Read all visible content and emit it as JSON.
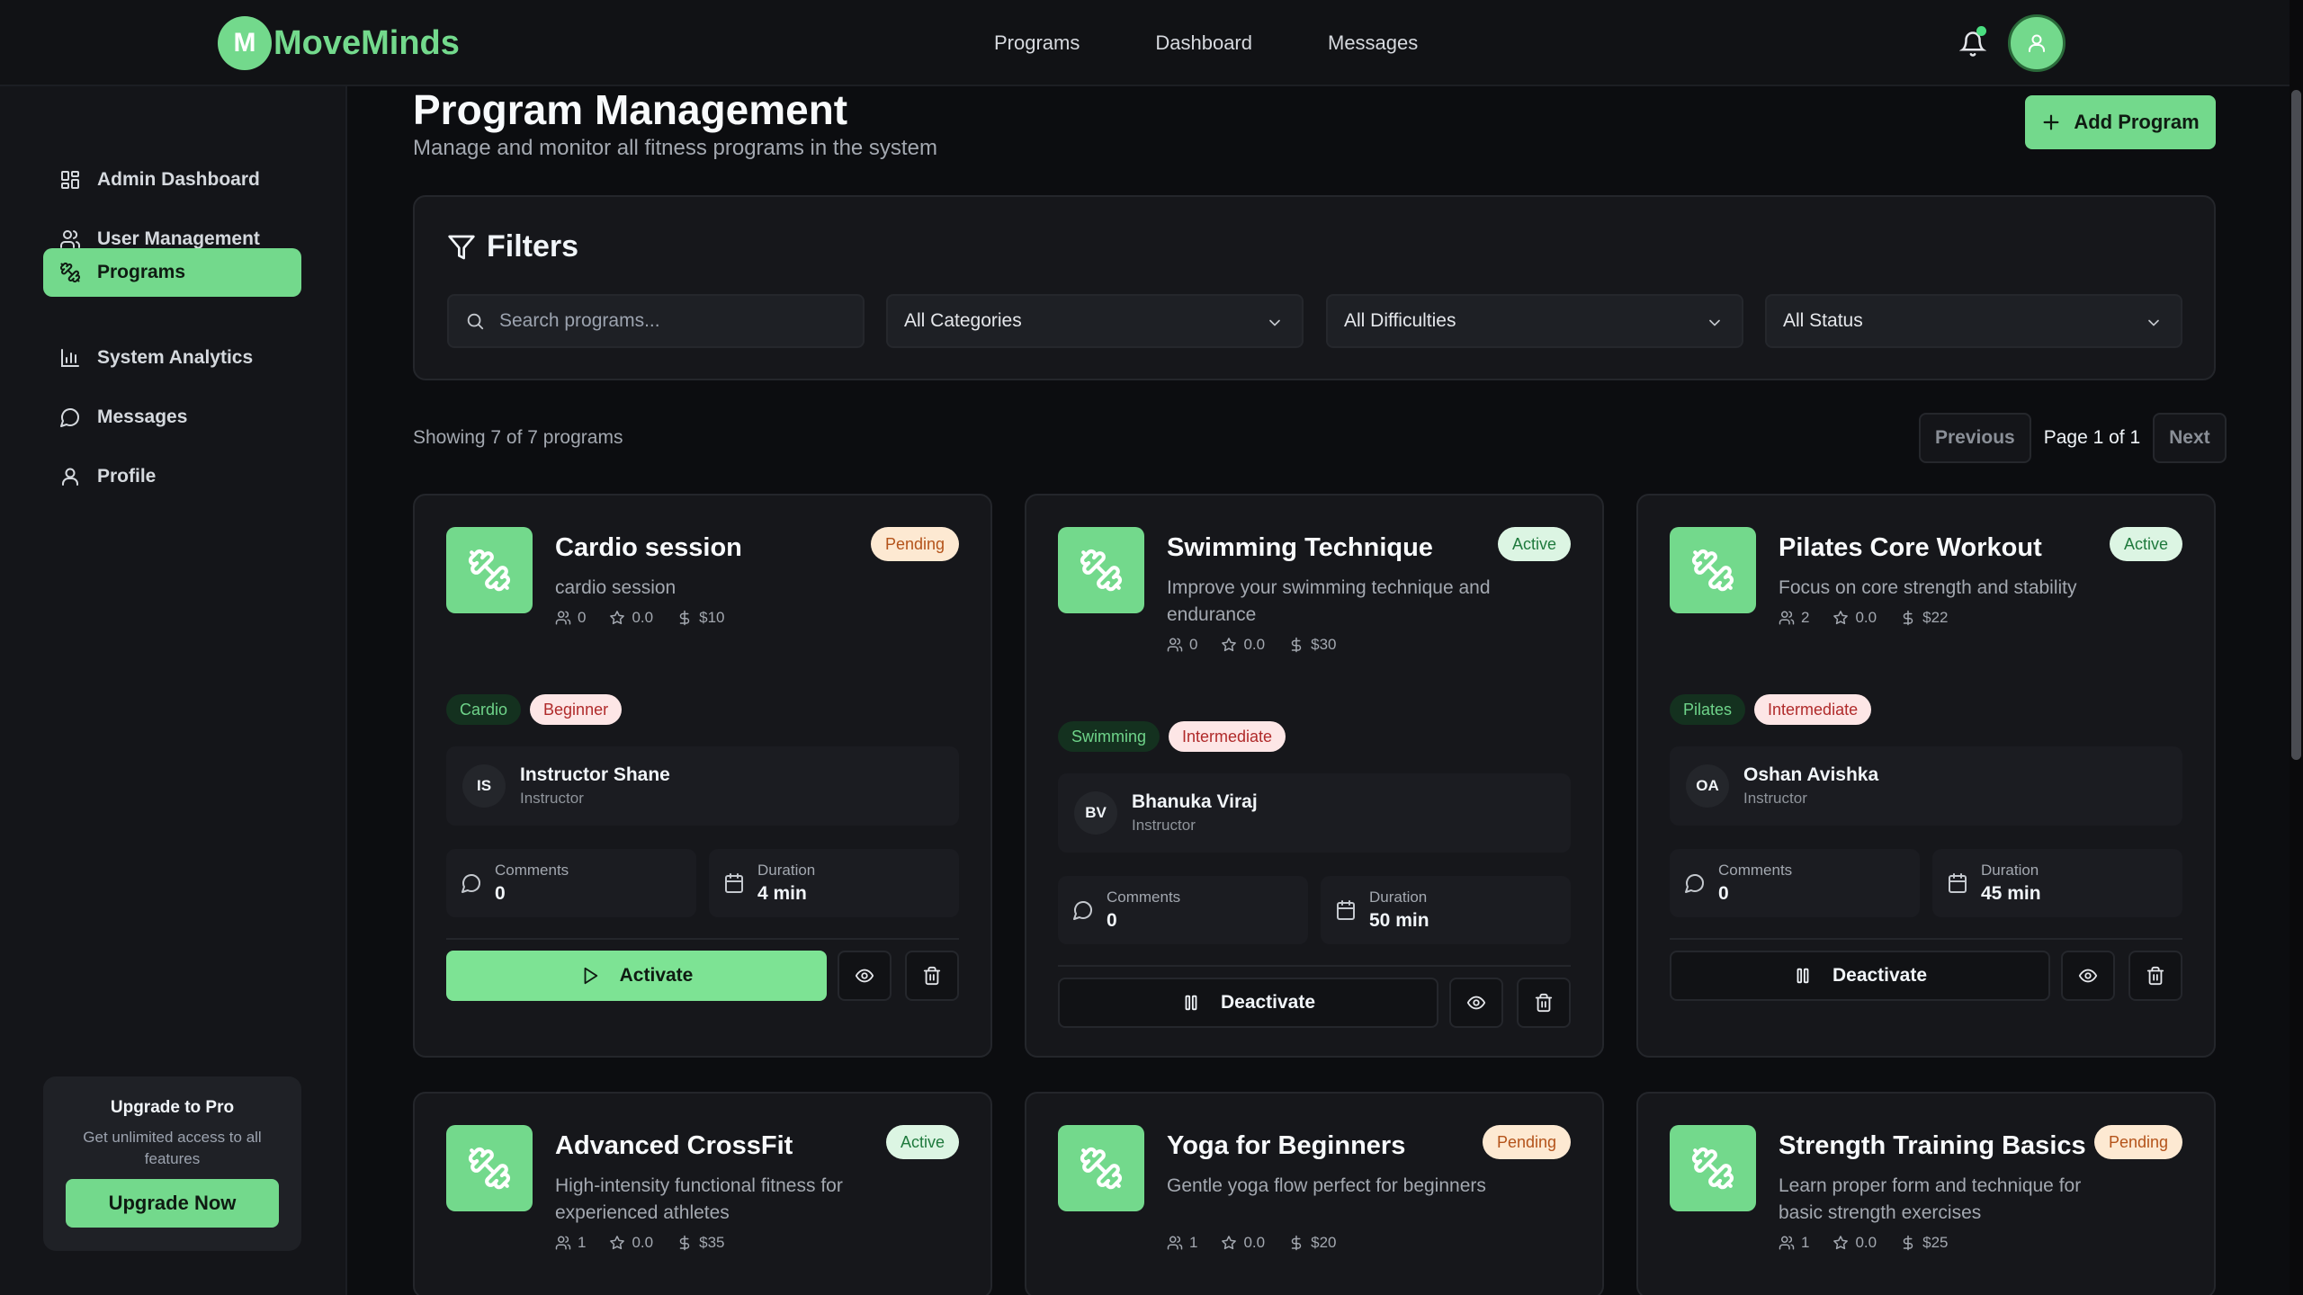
{
  "app": {
    "logo_letter": "M",
    "name": "MoveMinds",
    "accent": "#73d98c"
  },
  "topnav": [
    "Programs",
    "Dashboard",
    "Messages"
  ],
  "sidebar": {
    "items": [
      {
        "label": "Admin Dashboard",
        "icon": "dashboard-grid-icon"
      },
      {
        "label": "User Management",
        "icon": "users-icon"
      },
      {
        "label": "Programs",
        "icon": "dumbbell-icon",
        "active": true
      },
      {
        "label": "System Analytics",
        "icon": "bar-chart-icon"
      },
      {
        "label": "Messages",
        "icon": "message-icon"
      },
      {
        "label": "Profile",
        "icon": "user-icon"
      }
    ],
    "upgrade": {
      "title": "Upgrade to Pro",
      "desc": "Get unlimited access to all features",
      "button": "Upgrade Now"
    }
  },
  "header": {
    "title": "Program Management",
    "subtitle": "Manage and monitor all fitness programs in the system",
    "add_button": "Add Program"
  },
  "filters": {
    "title": "Filters",
    "search_placeholder": "Search programs...",
    "category": "All Categories",
    "difficulty": "All Difficulties",
    "status": "All Status"
  },
  "listing": {
    "showing": "Showing 7 of 7 programs",
    "prev": "Previous",
    "page": "Page 1 of 1",
    "next": "Next"
  },
  "labels": {
    "comments": "Comments",
    "duration": "Duration",
    "instructor": "Instructor"
  },
  "programs": [
    {
      "title": "Cardio session",
      "desc": "cardio session",
      "status": "Pending",
      "participants": "0",
      "rating": "0.0",
      "price": "$10",
      "category": "Cardio",
      "difficulty": "Beginner",
      "instructor_initials": "IS",
      "instructor": "Instructor Shane",
      "comments": "0",
      "duration": "4 min",
      "action": "Activate"
    },
    {
      "title": "Swimming Technique",
      "desc": "Improve your swimming technique and endurance",
      "status": "Active",
      "participants": "0",
      "rating": "0.0",
      "price": "$30",
      "category": "Swimming",
      "difficulty": "Intermediate",
      "instructor_initials": "BV",
      "instructor": "Bhanuka Viraj",
      "comments": "0",
      "duration": "50 min",
      "action": "Deactivate"
    },
    {
      "title": "Pilates Core Workout",
      "desc": "Focus on core strength and stability",
      "status": "Active",
      "participants": "2",
      "rating": "0.0",
      "price": "$22",
      "category": "Pilates",
      "difficulty": "Intermediate",
      "instructor_initials": "OA",
      "instructor": "Oshan Avishka",
      "comments": "0",
      "duration": "45 min",
      "action": "Deactivate"
    },
    {
      "title": "Advanced CrossFit",
      "desc": "High-intensity functional fitness for experienced athletes",
      "status": "Active",
      "participants": "1",
      "rating": "0.0",
      "price": "$35"
    },
    {
      "title": "Yoga for Beginners",
      "desc": "Gentle yoga flow perfect for beginners",
      "status": "Pending",
      "participants": "1",
      "rating": "0.0",
      "price": "$20"
    },
    {
      "title": "Strength Training Basics",
      "desc": "Learn proper form and technique for basic strength exercises",
      "status": "Pending",
      "participants": "1",
      "rating": "0.0",
      "price": "$25"
    }
  ]
}
